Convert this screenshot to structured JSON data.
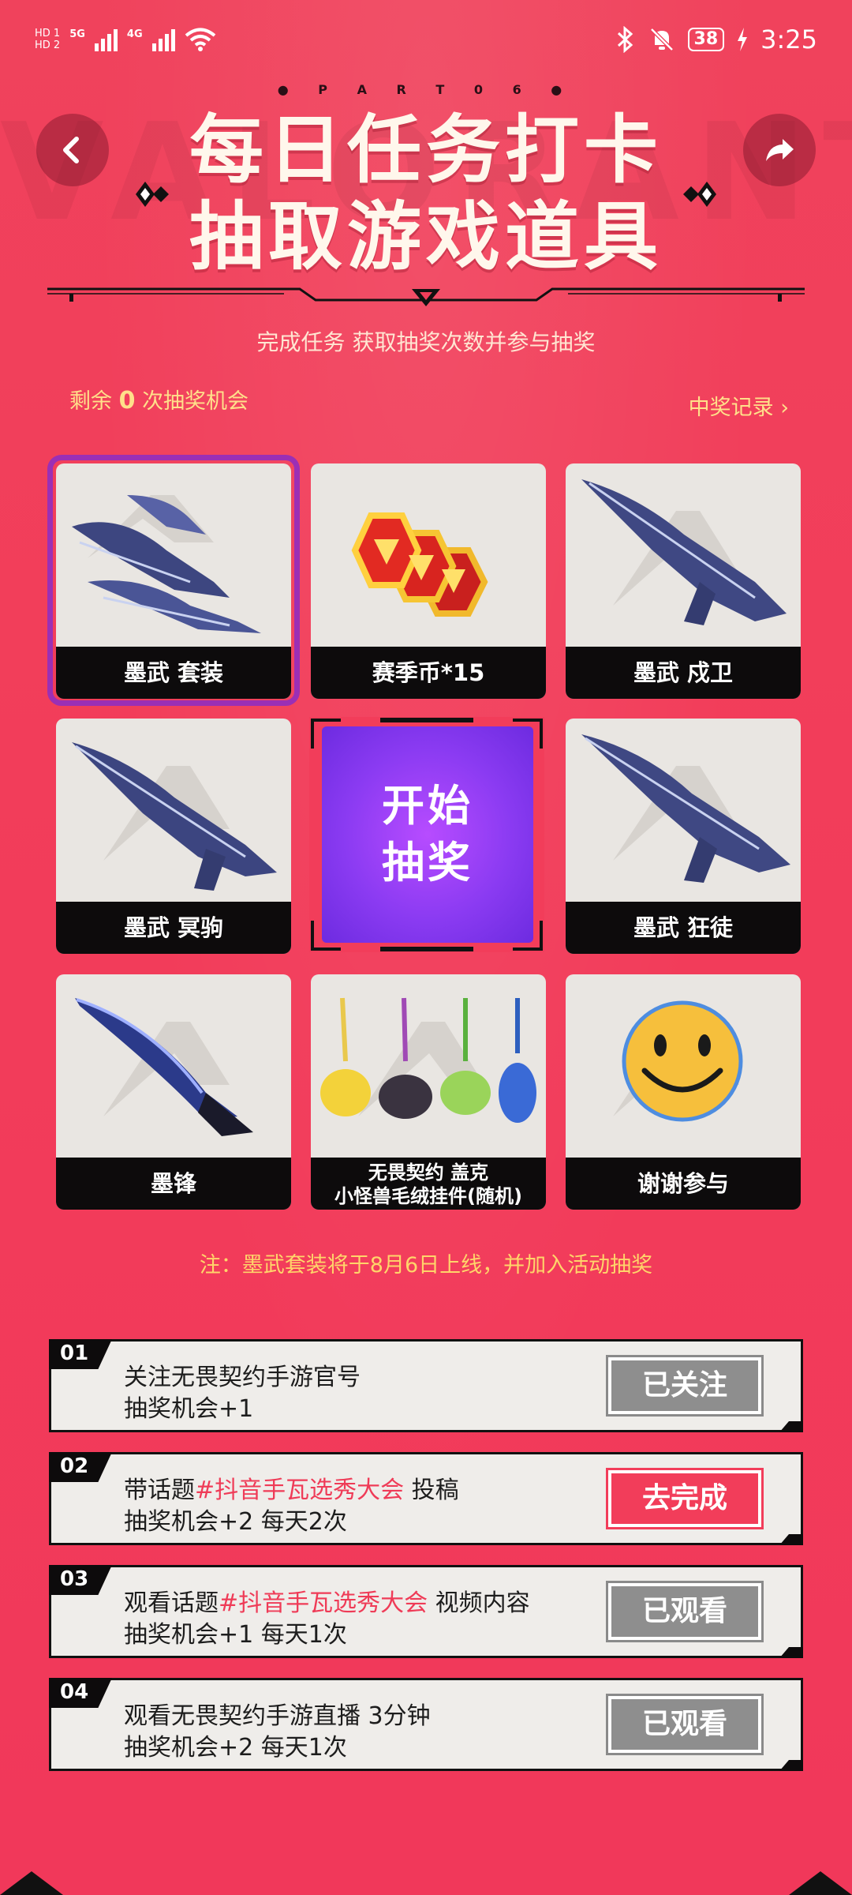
{
  "status_bar": {
    "hd1": "HD 1",
    "hd2": "HD 2",
    "net1": "5G",
    "net2": "4G",
    "battery": "38",
    "time": "3:25"
  },
  "header": {
    "part_label": "● P A R T 0 6 ●",
    "title_line1": "每日任务打卡",
    "title_line2": "抽取游戏道具",
    "subtitle": "完成任务 获取抽奖次数并参与抽奖",
    "remain_prefix": "剩余",
    "remain_count": "0",
    "remain_suffix": "次抽奖机会",
    "record_link": "中奖记录 ›"
  },
  "prizes": [
    {
      "label": "墨武 套装",
      "icon": "rifle-set-icon"
    },
    {
      "label": "赛季币*15",
      "icon": "season-coin-icon"
    },
    {
      "label": "墨武 戍卫",
      "icon": "rifle-icon"
    },
    {
      "label": "墨武 冥驹",
      "icon": "sniper-icon"
    },
    {
      "label": "墨武 狂徒",
      "icon": "rifle-icon"
    },
    {
      "label": "墨锋",
      "icon": "knife-icon"
    },
    {
      "label_line1": "无畏契约 盖克",
      "label_line2": "小怪兽毛绒挂件(随机)",
      "icon": "plush-keychain-icon"
    },
    {
      "label": "谢谢参与",
      "icon": "smiley-icon"
    }
  ],
  "start_button": {
    "line1": "开始",
    "line2": "抽奖"
  },
  "note": "注：墨武套装将于8月6日上线，并加入活动抽奖",
  "tasks": [
    {
      "num": "01",
      "line1": "关注无畏契约手游官号",
      "line1_hl": "",
      "line1_tail": "",
      "line2": "抽奖机会+1",
      "button": "已关注",
      "active": false
    },
    {
      "num": "02",
      "line1": "带话题",
      "line1_hl": "#抖音手瓦选秀大会",
      "line1_tail": " 投稿",
      "line2": "抽奖机会+2  每天2次",
      "button": "去完成",
      "active": true
    },
    {
      "num": "03",
      "line1": "观看话题",
      "line1_hl": "#抖音手瓦选秀大会",
      "line1_tail": " 视频内容",
      "line2": "抽奖机会+1  每天1次",
      "button": "已观看",
      "active": false
    },
    {
      "num": "04",
      "line1": "观看无畏契约手游直播 3分钟",
      "line1_hl": "",
      "line1_tail": "",
      "line2": "抽奖机会+2  每天1次",
      "button": "已观看",
      "active": false
    }
  ],
  "colors": {
    "background": "#f23d5a",
    "accent_yellow": "#ffe08a",
    "selection": "#9b2fb5",
    "start_purple": "#8b3bf2"
  }
}
